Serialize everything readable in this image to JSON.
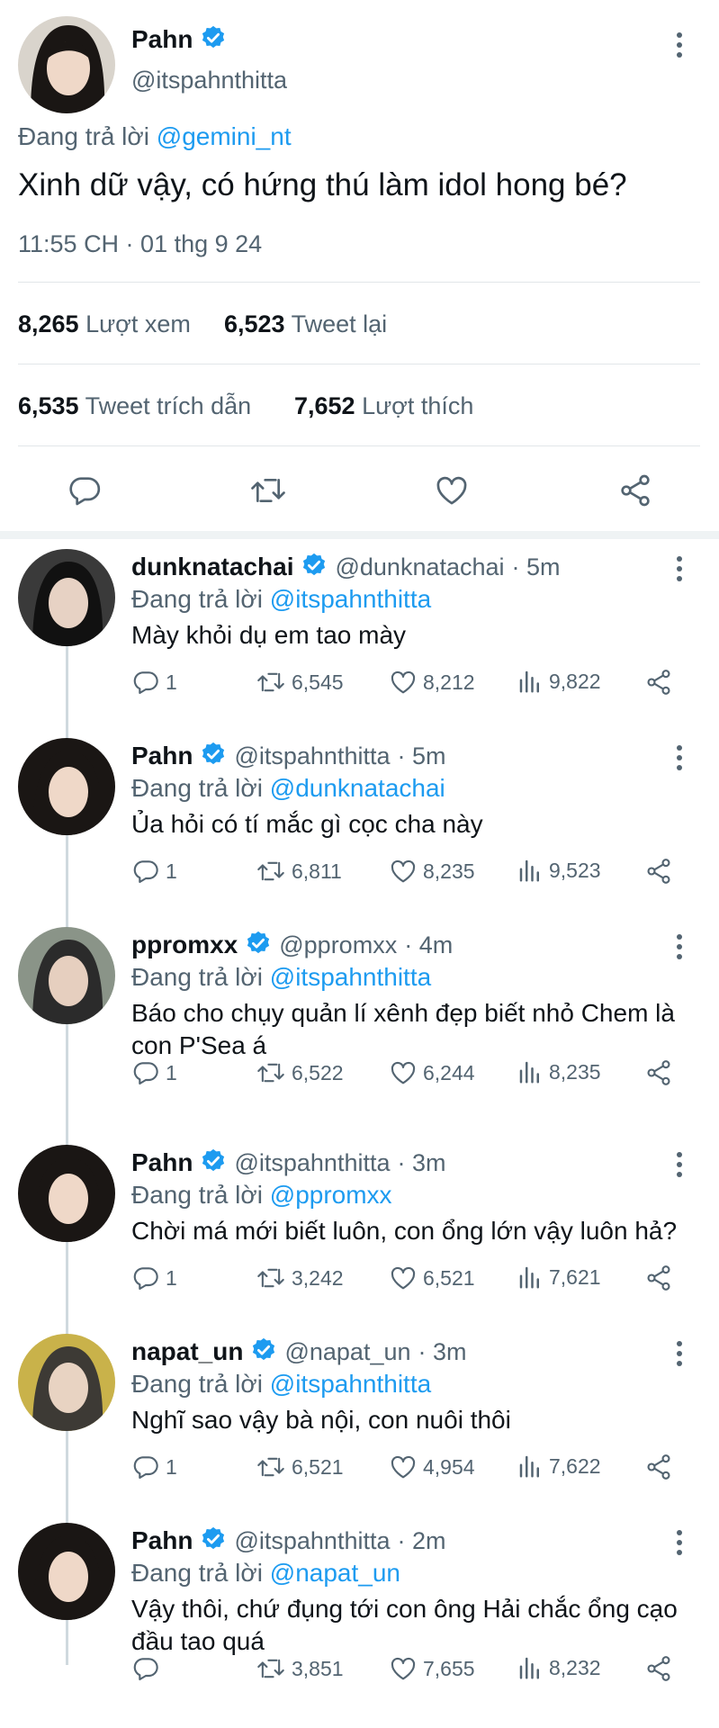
{
  "main": {
    "author": {
      "name": "Pahn",
      "handle": "@itspahnthitta"
    },
    "replying_prefix": "Đang trả lời",
    "replying_to": "@gemini_nt",
    "text": "Xinh dữ vậy, có hứng thú làm idol hong bé?",
    "timestamp": "11:55 CH · 01 thg 9 24",
    "stats": {
      "views_value": "8,265",
      "views_label": "Lượt xem",
      "retweets_value": "6,523",
      "retweets_label": "Tweet lại",
      "quotes_value": "6,535",
      "quotes_label": "Tweet trích dẫn",
      "likes_value": "7,652",
      "likes_label": "Lượt thích"
    }
  },
  "replies": [
    {
      "name": "dunknatachai",
      "handle": "@dunknatachai",
      "time": "· 5m",
      "replying_prefix": "Đang trả lời",
      "replying_to": "@itspahnthitta",
      "lines": [
        "Mày khỏi dụ em tao mày"
      ],
      "replies": "1",
      "retweets": "6,545",
      "likes": "8,212",
      "views": "9,822"
    },
    {
      "name": "Pahn",
      "handle": "@itspahnthitta",
      "time": "· 5m",
      "replying_prefix": "Đang trả lời",
      "replying_to": "@dunknatachai",
      "lines": [
        "Ủa hỏi có tí mắc gì cọc cha này"
      ],
      "replies": "1",
      "retweets": "6,811",
      "likes": "8,235",
      "views": "9,523"
    },
    {
      "name": "ppromxx",
      "handle": "@ppromxx",
      "time": "· 4m",
      "replying_prefix": "Đang trả lời",
      "replying_to": "@itspahnthitta",
      "lines": [
        "Báo cho chụy quản lí xênh đẹp biết nhỏ Chem là",
        "con P'Sea á"
      ],
      "replies": "1",
      "retweets": "6,522",
      "likes": "6,244",
      "views": "8,235"
    },
    {
      "name": "Pahn",
      "handle": "@itspahnthitta",
      "time": "· 3m",
      "replying_prefix": "Đang trả lời",
      "replying_to": "@ppromxx",
      "lines": [
        "Chời má mới biết luôn, con ổng lớn vậy luôn hả?"
      ],
      "replies": "1",
      "retweets": "3,242",
      "likes": "6,521",
      "views": "7,621"
    },
    {
      "name": "napat_un",
      "handle": "@napat_un",
      "time": "· 3m",
      "replying_prefix": "Đang trả lời",
      "replying_to": "@itspahnthitta",
      "lines": [
        "Nghĩ sao vậy bà nội, con nuôi thôi"
      ],
      "replies": "1",
      "retweets": "6,521",
      "likes": "4,954",
      "views": "7,622"
    },
    {
      "name": "Pahn",
      "handle": "@itspahnthitta",
      "time": "· 2m",
      "replying_prefix": "Đang trả lời",
      "replying_to": "@napat_un",
      "lines": [
        "Vậy thôi, chứ đụng tới con ông Hải chắc ổng cạo",
        "đầu tao quá"
      ],
      "replies": "",
      "retweets": "3,851",
      "likes": "7,655",
      "views": "8,232"
    }
  ],
  "icons": {
    "verified": "verified-badge-icon",
    "more": "more-options-icon",
    "reply": "reply-icon",
    "retweet": "retweet-icon",
    "like": "like-icon",
    "views": "views-icon",
    "share": "share-icon"
  },
  "colors": {
    "accent": "#1d9bf0",
    "secondary_text": "#536471",
    "divider": "#e2e6e9"
  }
}
